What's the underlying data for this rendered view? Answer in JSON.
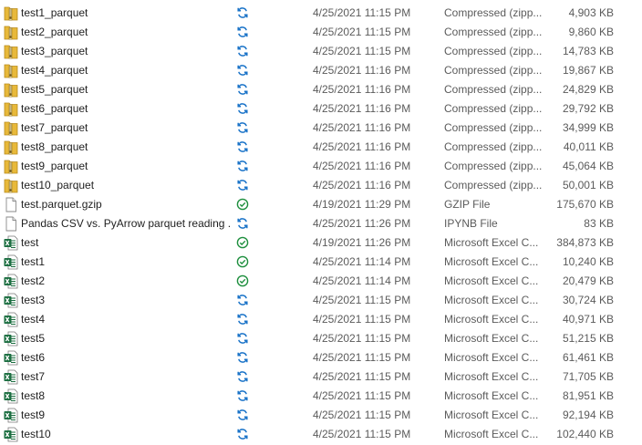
{
  "files": [
    {
      "name": "test1_parquet",
      "icon": "zip-folder-icon",
      "status": "sync-pending",
      "date": "4/25/2021 11:15 PM",
      "type": "Compressed (zipp...",
      "size": "4,903 KB"
    },
    {
      "name": "test2_parquet",
      "icon": "zip-folder-icon",
      "status": "sync-pending",
      "date": "4/25/2021 11:15 PM",
      "type": "Compressed (zipp...",
      "size": "9,860 KB"
    },
    {
      "name": "test3_parquet",
      "icon": "zip-folder-icon",
      "status": "sync-pending",
      "date": "4/25/2021 11:15 PM",
      "type": "Compressed (zipp...",
      "size": "14,783 KB"
    },
    {
      "name": "test4_parquet",
      "icon": "zip-folder-icon",
      "status": "sync-pending",
      "date": "4/25/2021 11:16 PM",
      "type": "Compressed (zipp...",
      "size": "19,867 KB"
    },
    {
      "name": "test5_parquet",
      "icon": "zip-folder-icon",
      "status": "sync-pending",
      "date": "4/25/2021 11:16 PM",
      "type": "Compressed (zipp...",
      "size": "24,829 KB"
    },
    {
      "name": "test6_parquet",
      "icon": "zip-folder-icon",
      "status": "sync-pending",
      "date": "4/25/2021 11:16 PM",
      "type": "Compressed (zipp...",
      "size": "29,792 KB"
    },
    {
      "name": "test7_parquet",
      "icon": "zip-folder-icon",
      "status": "sync-pending",
      "date": "4/25/2021 11:16 PM",
      "type": "Compressed (zipp...",
      "size": "34,999 KB"
    },
    {
      "name": "test8_parquet",
      "icon": "zip-folder-icon",
      "status": "sync-pending",
      "date": "4/25/2021 11:16 PM",
      "type": "Compressed (zipp...",
      "size": "40,011 KB"
    },
    {
      "name": "test9_parquet",
      "icon": "zip-folder-icon",
      "status": "sync-pending",
      "date": "4/25/2021 11:16 PM",
      "type": "Compressed (zipp...",
      "size": "45,064 KB"
    },
    {
      "name": "test10_parquet",
      "icon": "zip-folder-icon",
      "status": "sync-pending",
      "date": "4/25/2021 11:16 PM",
      "type": "Compressed (zipp...",
      "size": "50,001 KB"
    },
    {
      "name": "test.parquet.gzip",
      "icon": "blank-file-icon",
      "status": "synced",
      "date": "4/19/2021 11:29 PM",
      "type": "GZIP File",
      "size": "175,670 KB"
    },
    {
      "name": "Pandas CSV vs. PyArrow parquet reading ...",
      "icon": "blank-file-icon",
      "status": "sync-pending",
      "date": "4/25/2021 11:26 PM",
      "type": "IPYNB File",
      "size": "83 KB"
    },
    {
      "name": "test",
      "icon": "excel-file-icon",
      "status": "synced",
      "date": "4/19/2021 11:26 PM",
      "type": "Microsoft Excel C...",
      "size": "384,873 KB"
    },
    {
      "name": "test1",
      "icon": "excel-file-icon",
      "status": "synced",
      "date": "4/25/2021 11:14 PM",
      "type": "Microsoft Excel C...",
      "size": "10,240 KB"
    },
    {
      "name": "test2",
      "icon": "excel-file-icon",
      "status": "synced",
      "date": "4/25/2021 11:14 PM",
      "type": "Microsoft Excel C...",
      "size": "20,479 KB"
    },
    {
      "name": "test3",
      "icon": "excel-file-icon",
      "status": "sync-pending",
      "date": "4/25/2021 11:15 PM",
      "type": "Microsoft Excel C...",
      "size": "30,724 KB"
    },
    {
      "name": "test4",
      "icon": "excel-file-icon",
      "status": "sync-pending",
      "date": "4/25/2021 11:15 PM",
      "type": "Microsoft Excel C...",
      "size": "40,971 KB"
    },
    {
      "name": "test5",
      "icon": "excel-file-icon",
      "status": "sync-pending",
      "date": "4/25/2021 11:15 PM",
      "type": "Microsoft Excel C...",
      "size": "51,215 KB"
    },
    {
      "name": "test6",
      "icon": "excel-file-icon",
      "status": "sync-pending",
      "date": "4/25/2021 11:15 PM",
      "type": "Microsoft Excel C...",
      "size": "61,461 KB"
    },
    {
      "name": "test7",
      "icon": "excel-file-icon",
      "status": "sync-pending",
      "date": "4/25/2021 11:15 PM",
      "type": "Microsoft Excel C...",
      "size": "71,705 KB"
    },
    {
      "name": "test8",
      "icon": "excel-file-icon",
      "status": "sync-pending",
      "date": "4/25/2021 11:15 PM",
      "type": "Microsoft Excel C...",
      "size": "81,951 KB"
    },
    {
      "name": "test9",
      "icon": "excel-file-icon",
      "status": "sync-pending",
      "date": "4/25/2021 11:15 PM",
      "type": "Microsoft Excel C...",
      "size": "92,194 KB"
    },
    {
      "name": "test10",
      "icon": "excel-file-icon",
      "status": "sync-pending",
      "date": "4/25/2021 11:15 PM",
      "type": "Microsoft Excel C...",
      "size": "102,440 KB"
    }
  ],
  "colors": {
    "sync_pending": "#1a73c8",
    "synced": "#1e8f3e",
    "zip_folder": "#e8b93a",
    "excel": "#1d6f42"
  }
}
